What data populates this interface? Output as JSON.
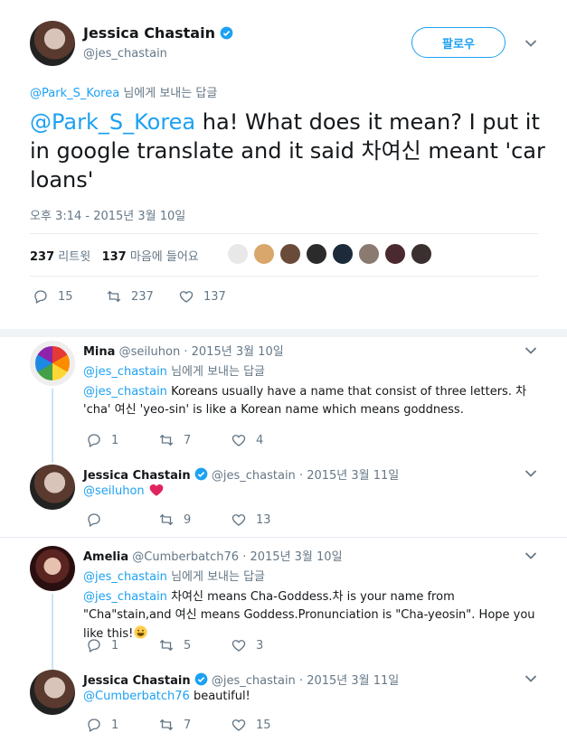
{
  "main": {
    "author": {
      "name": "Jessica Chastain",
      "handle": "@jes_chastain"
    },
    "follow_label": "팔로우",
    "reply_context": {
      "mention": "@Park_S_Korea",
      "suffix": " 님에게 보내는 답글"
    },
    "text": {
      "mention": "@Park_S_Korea",
      "body": " ha! What does it mean? I put it in google translate and it said 차여신 meant 'car loans'"
    },
    "timestamp": "오후 3:14 - 2015년 3월 10일",
    "stats": {
      "retweets": "237",
      "retweets_label": "리트윗",
      "likes": "137",
      "likes_label": "마음에 들어요"
    },
    "actions": {
      "replies": "15",
      "retweets": "237",
      "likes": "137"
    }
  },
  "replies": [
    {
      "name": "Mina",
      "handle": "@seiluhon",
      "date": "· 2015년 3월 10일",
      "context_mention": "@jes_chastain",
      "context_suffix": " 님에게 보내는 답글",
      "mention": "@jes_chastain",
      "body": " Koreans usually have a name that consist of three letters. 차 'cha' 여신 'yeo-sin' is like a Korean name which means goddness.",
      "replies": "1",
      "retweets": "7",
      "likes": "4"
    },
    {
      "name": "Jessica Chastain",
      "handle": "@jes_chastain",
      "date": "· 2015년 3월 11일",
      "mention": "@seiluhon",
      "body": " ",
      "replies": "",
      "retweets": "9",
      "likes": "13"
    },
    {
      "name": "Amelia",
      "handle": "@Cumberbatch76",
      "date": "· 2015년 3월 10일",
      "context_mention": "@jes_chastain",
      "context_suffix": " 님에게 보내는 답글",
      "mention": "@jes_chastain",
      "body": " 차여신 means Cha-Goddess.차 is  your name from \"Cha\"stain,and 여신 means Goddess.Pronunciation is \"Cha-yeosin\". Hope you like this!",
      "replies": "1",
      "retweets": "5",
      "likes": "3"
    },
    {
      "name": "Jessica Chastain",
      "handle": "@jes_chastain",
      "date": "· 2015년 3월 11일",
      "mention": "@Cumberbatch76",
      "body": " beautiful!",
      "replies": "1",
      "retweets": "7",
      "likes": "15"
    }
  ],
  "colors": {
    "accent": "#1da1f2",
    "muted": "#657786",
    "heart": "#e0245e"
  }
}
